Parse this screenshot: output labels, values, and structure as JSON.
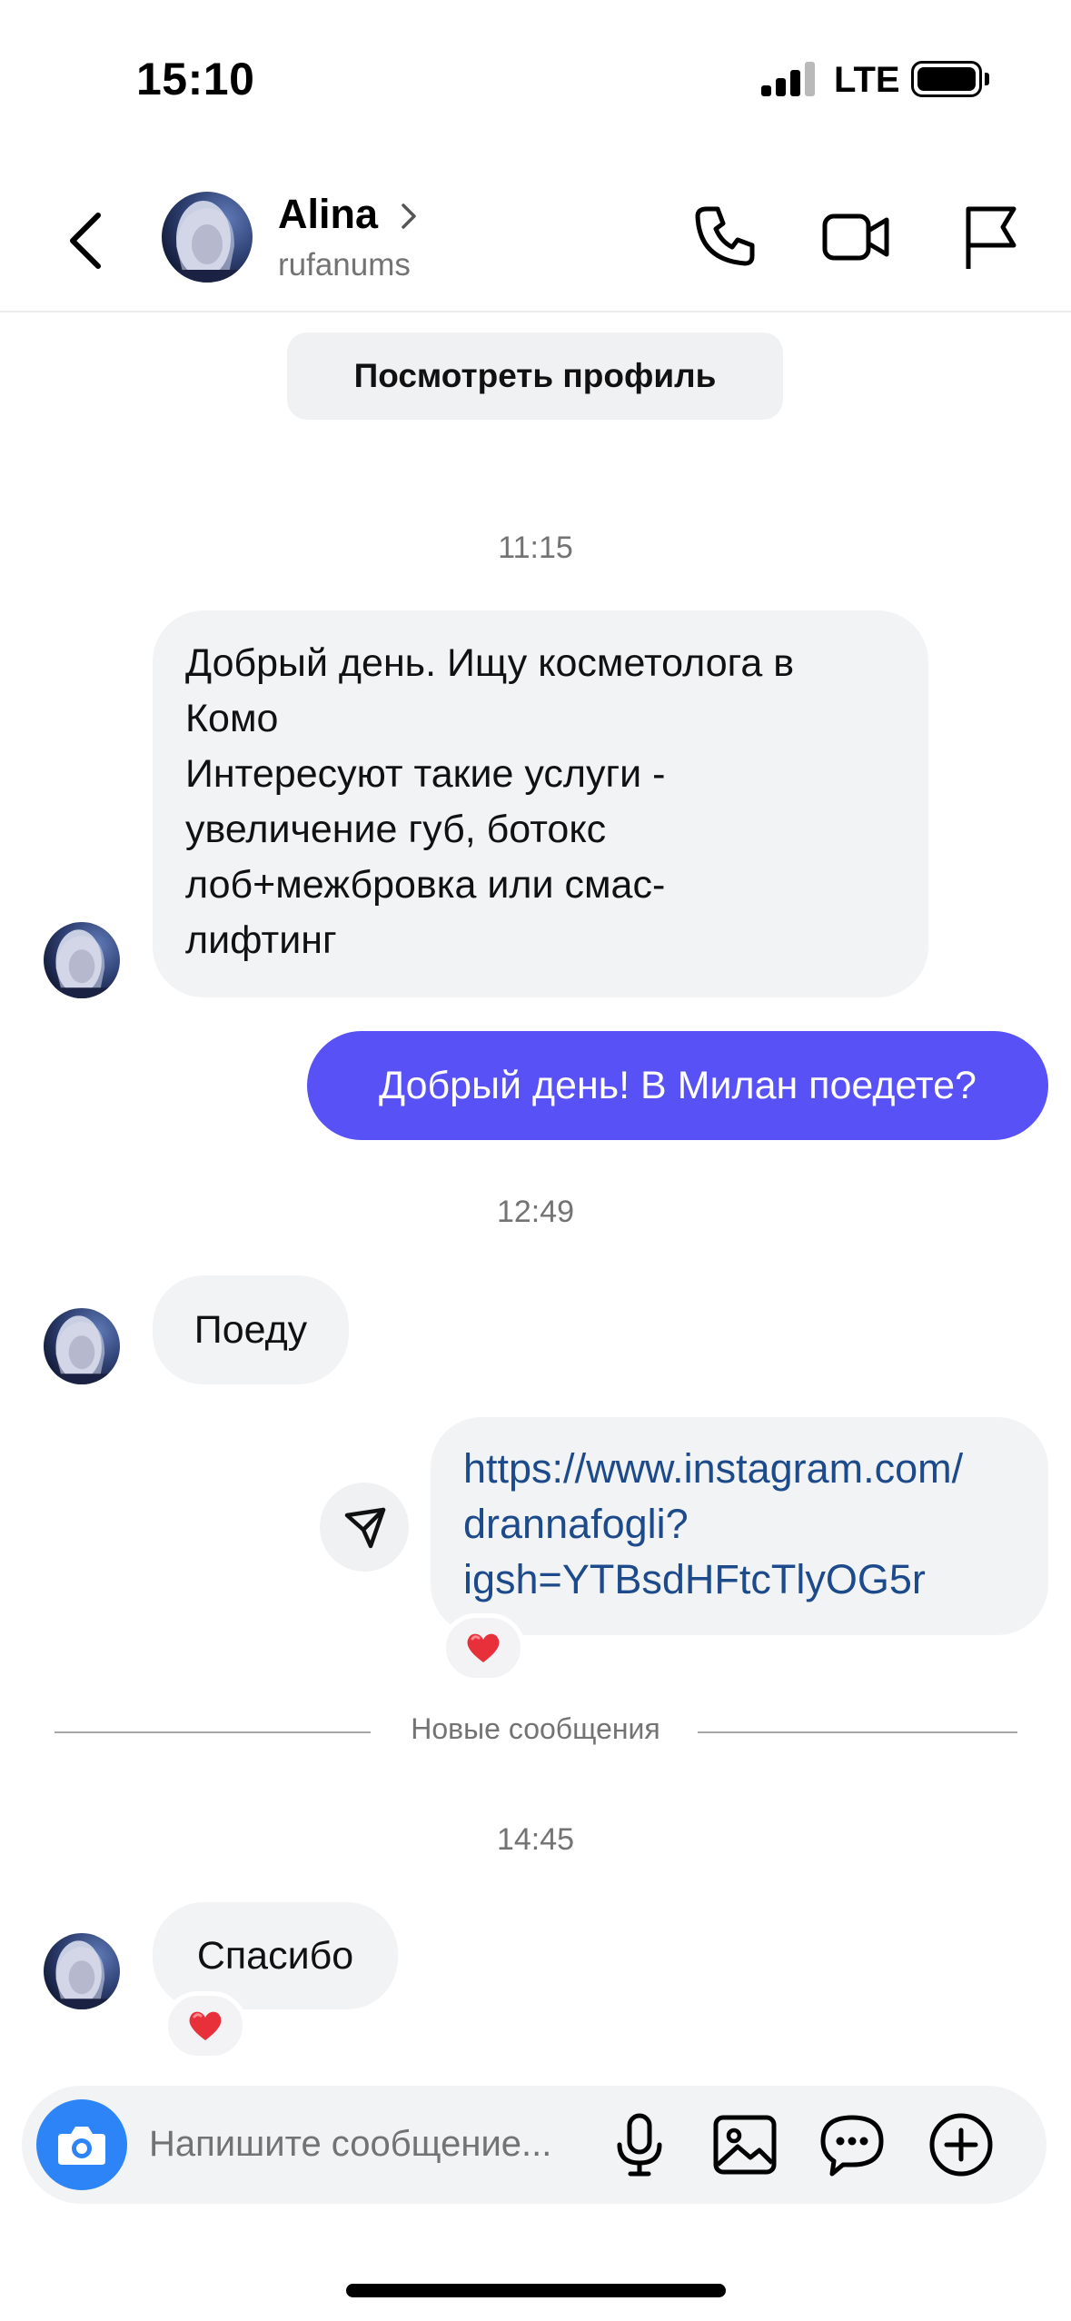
{
  "status_bar": {
    "time": "15:10",
    "network": "LTE",
    "icons": [
      "signal-icon",
      "battery-icon"
    ]
  },
  "header": {
    "contact_name": "Alina",
    "contact_handle": "rufanums",
    "icons": [
      "back-icon",
      "chevron-right-icon",
      "phone-icon",
      "video-camera-icon",
      "flag-icon"
    ]
  },
  "view_profile_label": "Посмотреть профиль",
  "messages": [
    {
      "timestamp": "11:15",
      "direction": "incoming",
      "lines": [
        "Добрый день. Ищу косметолога в",
        "Комо",
        "Интересуют такие услуги -",
        "увеличение губ, ботокс",
        "лоб+межбровка или смас-",
        "лифтинг"
      ]
    },
    {
      "direction": "outgoing",
      "text": "Добрый день! В Милан поедете?"
    },
    {
      "timestamp": "12:49",
      "direction": "incoming",
      "text": "Поеду"
    },
    {
      "direction": "outgoing",
      "lines": [
        "https://www.instagram.com/",
        "drannafogli?",
        "igsh=YTBsdHFtcTlyOG5r"
      ],
      "reaction": "heart"
    },
    {
      "timestamp": "14:45",
      "direction": "incoming",
      "text": "Спасибо",
      "reaction": "heart"
    }
  ],
  "new_messages_label": "Новые сообщения",
  "composer": {
    "placeholder": "Напишите сообщение...",
    "icons": [
      "camera-icon",
      "microphone-icon",
      "gallery-icon",
      "sticker-icon",
      "plus-icon"
    ]
  },
  "colors": {
    "outgoing_bubble": "#5851f6",
    "incoming_bubble": "#f2f3f5",
    "link": "#1c4a8a",
    "camera_button": "#2d84f6",
    "reaction_heart": "#e8303a"
  }
}
